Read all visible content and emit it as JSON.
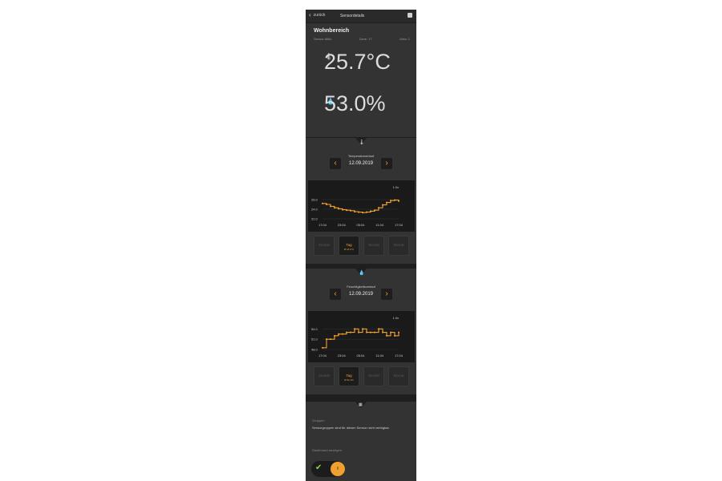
{
  "topbar": {
    "back_label": "zurück",
    "title": "Sensordetails",
    "save_icon": "save-icon"
  },
  "header": {
    "room": "Wohnbereich",
    "meta_left": "Sensor Aktiv",
    "meta_mid": "Zone: 17",
    "meta_right": "Area: 1",
    "temperature": "25.7°C",
    "humidity": "53.0%"
  },
  "temperature_section": {
    "icon": "thermometer-icon",
    "title": "Temperaturverlauf",
    "date": "12.09.2019",
    "chart_data": {
      "type": "line",
      "x_ticks": [
        "17:04",
        "23:04",
        "05:04",
        "11:04",
        "17:04"
      ],
      "y_ticks": [
        "26.0",
        "24.0",
        "22.0"
      ],
      "ylim": [
        22,
        27
      ],
      "zoom": "1.0x",
      "color": "#f0a030",
      "values": [
        25.2,
        25.0,
        24.6,
        24.3,
        24.1,
        23.9,
        23.8,
        23.7,
        23.5,
        23.4,
        23.3,
        23.4,
        23.6,
        23.8,
        24.3,
        24.9,
        25.4,
        25.8,
        25.9,
        25.7
      ]
    },
    "ranges": [
      {
        "label": "Stunde",
        "sub": "",
        "active": false
      },
      {
        "label": "Tag",
        "sub": "Ø 24.6°C",
        "active": true
      },
      {
        "label": "Woche",
        "sub": "",
        "active": false
      },
      {
        "label": "Monat",
        "sub": "",
        "active": false
      }
    ]
  },
  "humidity_section": {
    "icon": "droplet-icon",
    "title": "Feuchtigkeitsverlauf",
    "date": "12.09.2019",
    "chart_data": {
      "type": "line",
      "x_ticks": [
        "17:04",
        "23:04",
        "05:04",
        "11:04",
        "17:04"
      ],
      "y_ticks": [
        "54.0",
        "51.0",
        "48.0"
      ],
      "ylim": [
        48,
        55
      ],
      "zoom": "1.0x",
      "color": "#f0a030",
      "values": [
        48.5,
        51.0,
        51.0,
        52.0,
        52.5,
        52.5,
        53.0,
        53.0,
        54.0,
        53.0,
        54.0,
        53.0,
        53.0,
        53.0,
        54.0,
        53.0,
        52.0,
        53.0,
        52.0,
        53.0
      ]
    },
    "ranges": [
      {
        "label": "Stunde",
        "sub": "",
        "active": false
      },
      {
        "label": "Tag",
        "sub": "Ø 52.1%",
        "active": true
      },
      {
        "label": "Woche",
        "sub": "",
        "active": false
      },
      {
        "label": "Monat",
        "sub": "",
        "active": false
      }
    ]
  },
  "groups": {
    "icon": "grid-icon",
    "label": "Gruppen",
    "text": "Sensorgruppen sind für diesen Sensor nicht verfügbar.",
    "dashboard_label": "Dashboard anzeigen",
    "toggle_knob": "ll"
  }
}
